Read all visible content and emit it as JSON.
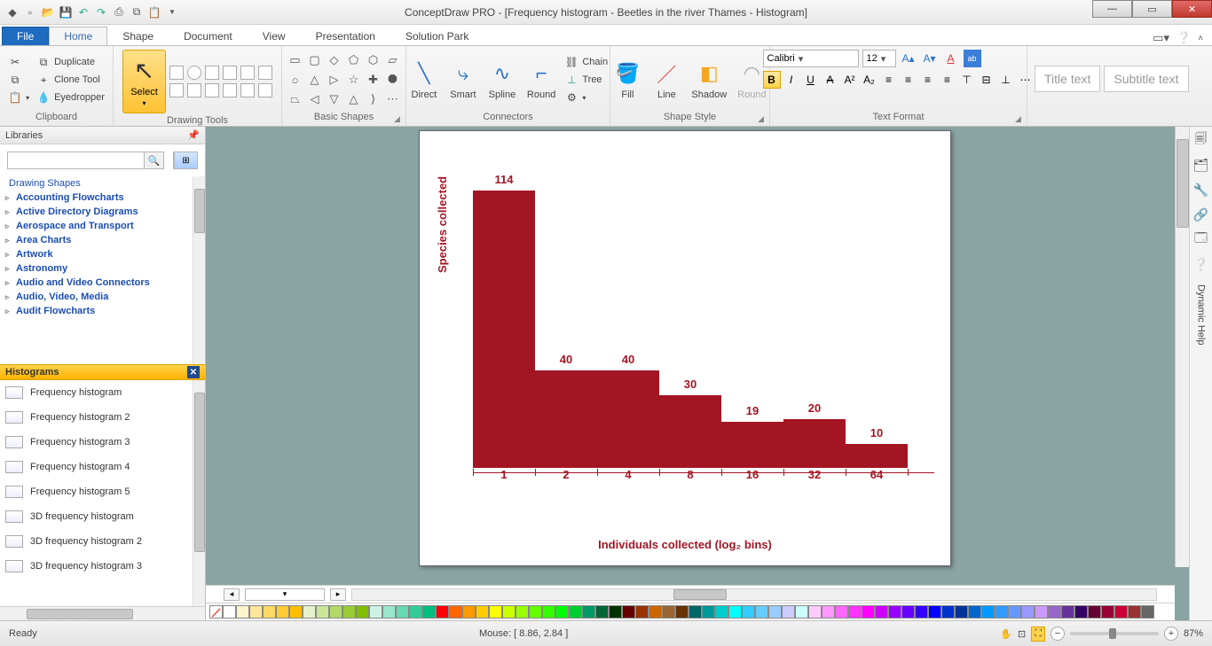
{
  "app": {
    "title": "ConceptDraw PRO - [Frequency histogram - Beetles in the river Thames - Histogram]"
  },
  "tabs": {
    "file": "File",
    "home": "Home",
    "shape": "Shape",
    "document": "Document",
    "view": "View",
    "presentation": "Presentation",
    "solution": "Solution Park"
  },
  "ribbon": {
    "clipboard": {
      "label": "Clipboard",
      "duplicate": "Duplicate",
      "clone": "Clone Tool",
      "eyedropper": "Eyedropper"
    },
    "drawing": {
      "label": "Drawing Tools",
      "select": "Select"
    },
    "basicshapes": {
      "label": "Basic Shapes"
    },
    "connectors": {
      "label": "Connectors",
      "direct": "Direct",
      "smart": "Smart",
      "spline": "Spline",
      "round": "Round",
      "chain": "Chain",
      "tree": "Tree"
    },
    "shapestyle": {
      "label": "Shape Style",
      "fill": "Fill",
      "line": "Line",
      "shadow": "Shadow",
      "round": "Round"
    },
    "textformat": {
      "label": "Text Format",
      "font": "Calibri",
      "size": "12"
    },
    "title_ph": "Title text",
    "subtitle_ph": "Subtitle text"
  },
  "libraries": {
    "header": "Libraries",
    "tree": [
      "Drawing Shapes",
      "Accounting Flowcharts",
      "Active Directory Diagrams",
      "Aerospace and Transport",
      "Area Charts",
      "Artwork",
      "Astronomy",
      "Audio and Video Connectors",
      "Audio, Video, Media",
      "Audit Flowcharts"
    ],
    "hist_header": "Histograms",
    "hist_items": [
      "Frequency histogram",
      "Frequency histogram 2",
      "Frequency histogram 3",
      "Frequency histogram 4",
      "Frequency histogram 5",
      "3D frequency histogram",
      "3D frequency histogram 2",
      "3D frequency histogram 3"
    ]
  },
  "status": {
    "ready": "Ready",
    "mouse": "Mouse: [ 8.86, 2.84 ]",
    "zoom": "87%"
  },
  "rsb": {
    "dynhelp": "Dynamic Help"
  },
  "chart_data": {
    "type": "bar",
    "categories": [
      "1",
      "2",
      "4",
      "8",
      "16",
      "32",
      "64"
    ],
    "values": [
      114,
      40,
      40,
      30,
      19,
      20,
      10
    ],
    "xlabel": "Individuals collected (log₂ bins)",
    "ylabel": "Species collected",
    "ylim": [
      0,
      120
    ],
    "color": "#a31523"
  },
  "palette": [
    "#ffffff",
    "#fff4cc",
    "#ffe699",
    "#ffd966",
    "#ffcc33",
    "#ffbf00",
    "#e6f2cc",
    "#cce699",
    "#b3d966",
    "#99cc33",
    "#80bf00",
    "#ccf2e6",
    "#99e6cc",
    "#66d9b3",
    "#33cc99",
    "#00bf80",
    "#ff0000",
    "#ff6600",
    "#ff9900",
    "#ffcc00",
    "#ffff00",
    "#ccff00",
    "#99ff00",
    "#66ff00",
    "#33ff00",
    "#00ff00",
    "#00cc33",
    "#009966",
    "#006633",
    "#003300",
    "#660000",
    "#993300",
    "#cc6600",
    "#996633",
    "#663300",
    "#006666",
    "#009999",
    "#00cccc",
    "#00ffff",
    "#33ccff",
    "#66ccff",
    "#99ccff",
    "#ccccff",
    "#ccffff",
    "#ffccff",
    "#ff99ff",
    "#ff66ff",
    "#ff33ff",
    "#ff00ff",
    "#cc00ff",
    "#9900ff",
    "#6600ff",
    "#3300ff",
    "#0000ff",
    "#0033cc",
    "#003399",
    "#0066cc",
    "#0099ff",
    "#3399ff",
    "#6699ff",
    "#9999ff",
    "#cc99ff",
    "#9966cc",
    "#663399",
    "#330066",
    "#660033",
    "#990033",
    "#cc0033",
    "#993333",
    "#666666"
  ]
}
